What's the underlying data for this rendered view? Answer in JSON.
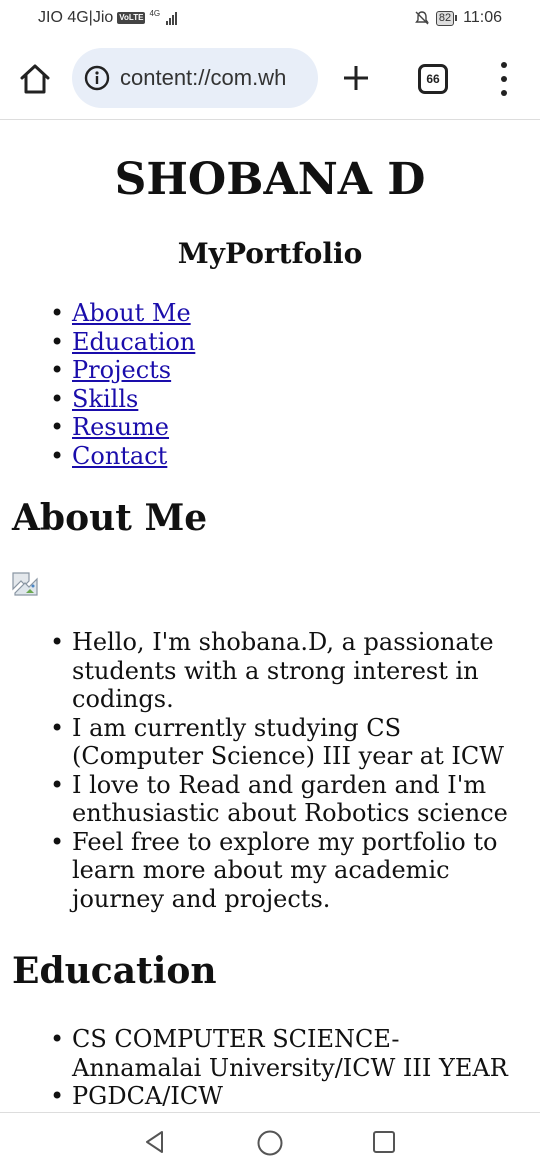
{
  "status": {
    "carrier": "JIO 4G|Jio",
    "volte": "VoLTE",
    "network": "4G",
    "battery": "82",
    "time": "11:06"
  },
  "browser": {
    "url": "content://com.wh",
    "tabs_count": "66",
    "icons": [
      "home-icon",
      "info-icon",
      "plus-icon",
      "tabs-icon",
      "overflow-menu-icon"
    ]
  },
  "page": {
    "title": "SHOBANA D",
    "subtitle": "MyPortfolio",
    "nav": [
      "About Me",
      "Education",
      "Projects",
      "Skills",
      "Resume",
      "Contact"
    ],
    "about": {
      "heading": "About Me",
      "items": [
        "Hello, I'm shobana.D, a passionate students with a strong interest in codings.",
        "I am currently studying CS (Computer Science) III year at ICW",
        "I love to Read and garden and I'm enthusiastic about Robotics science",
        "Feel free to explore my portfolio to learn more about my academic journey and projects."
      ]
    },
    "education": {
      "heading": "Education",
      "items": [
        "CS COMPUTER SCIENCE- Annamalai University/ICW III YEAR",
        "PGDCA/ICW"
      ]
    }
  },
  "system_nav": {
    "icons": [
      "back-icon",
      "home-circle-icon",
      "recents-icon"
    ]
  },
  "colors": {
    "link": "#1a0dab",
    "url_bar": "#e8eef8"
  }
}
